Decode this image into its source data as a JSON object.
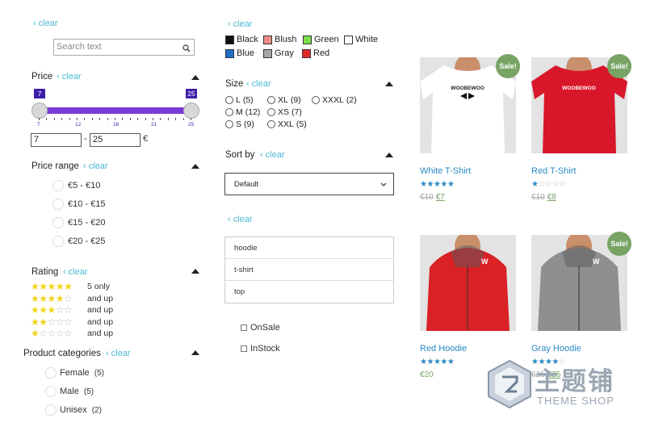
{
  "search": {
    "clear_label": "clear",
    "placeholder": "Search text"
  },
  "price": {
    "title": "Price",
    "clear_label": "clear",
    "min_value": "7",
    "max_value": "25",
    "ticks": [
      "7",
      "12",
      "16",
      "21",
      "25"
    ],
    "min_input": "7",
    "max_input": "25",
    "dash": "-",
    "currency": "€"
  },
  "price_range": {
    "title": "Price range",
    "clear_label": "clear",
    "items": [
      {
        "label": "€5 - €10"
      },
      {
        "label": "€10 - €15"
      },
      {
        "label": "€15 - €20"
      },
      {
        "label": "€20 - €25"
      }
    ]
  },
  "rating": {
    "title": "Rating",
    "clear_label": "clear",
    "items": [
      {
        "stars": 5,
        "label": "5 only"
      },
      {
        "stars": 4,
        "label": "and up"
      },
      {
        "stars": 3,
        "label": "and up"
      },
      {
        "stars": 2,
        "label": "and up"
      },
      {
        "stars": 1,
        "label": "and up"
      }
    ]
  },
  "categories": {
    "title": "Product categories",
    "clear_label": "clear",
    "items": [
      {
        "label": "Female",
        "count": "(5)"
      },
      {
        "label": "Male",
        "count": "(5)"
      },
      {
        "label": "Unisex",
        "count": "(2)"
      }
    ]
  },
  "color": {
    "clear_label": "clear",
    "items": [
      {
        "label": "Black",
        "hex": "#111111"
      },
      {
        "label": "Blush",
        "hex": "#f08c8c"
      },
      {
        "label": "Green",
        "hex": "#7be04a"
      },
      {
        "label": "White",
        "hex": "#ffffff"
      },
      {
        "label": "Blue",
        "hex": "#1e6fc9"
      },
      {
        "label": "Gray",
        "hex": "#a7a7a7"
      },
      {
        "label": "Red",
        "hex": "#e02a2a"
      }
    ]
  },
  "size": {
    "title": "Size",
    "clear_label": "clear",
    "items": [
      {
        "label": "L",
        "count": "(5)"
      },
      {
        "label": "XL",
        "count": "(9)"
      },
      {
        "label": "XXXL",
        "count": "(2)"
      },
      {
        "label": "M",
        "count": "(12)"
      },
      {
        "label": "XS",
        "count": "(7)"
      },
      {
        "label": "S",
        "count": "(9)"
      },
      {
        "label": "XXL",
        "count": "(5)"
      }
    ]
  },
  "sort": {
    "title": "Sort by",
    "clear_label": "clear",
    "selected": "Default"
  },
  "tags": {
    "clear_label": "clear",
    "items": [
      {
        "label": "hoodie"
      },
      {
        "label": "t-shirt"
      },
      {
        "label": "top"
      }
    ]
  },
  "checks": [
    {
      "label": "OnSale"
    },
    {
      "label": "InStock"
    }
  ],
  "products": [
    {
      "name": "White T-Shirt",
      "rating": 5,
      "old_price": "€10",
      "price": "€7",
      "sale": true,
      "sale_label": "Sale!",
      "shirt": "#ffffff",
      "shirt_text": "WOOBEWOO"
    },
    {
      "name": "Red T-Shirt",
      "rating": 1,
      "old_price": "€10",
      "price": "€8",
      "sale": true,
      "sale_label": "Sale!",
      "shirt": "#d9172b",
      "shirt_text": "WOOBEWOO"
    },
    {
      "name": "Red Hoodie",
      "rating": 5,
      "old_price": "",
      "price": "€20",
      "sale": false,
      "sale_label": "",
      "shirt": "#d92126",
      "shirt_text": ""
    },
    {
      "name": "Gray Hoodie",
      "rating": 4,
      "old_price": "€25",
      "price": "€25",
      "sale": true,
      "sale_label": "Sale!",
      "shirt": "#8e8f91",
      "shirt_text": ""
    }
  ],
  "watermark": {
    "cn_text": "主题铺",
    "en_text": "THEME SHOP"
  }
}
